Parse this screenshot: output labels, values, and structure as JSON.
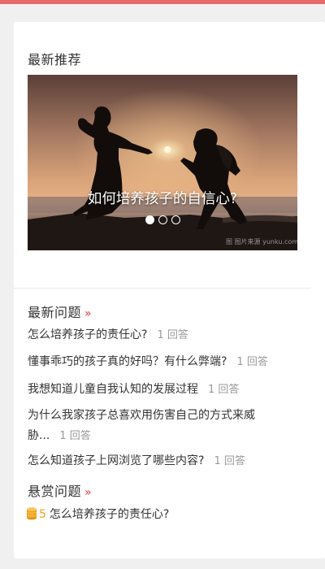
{
  "accent_color": "#e86a6a",
  "recommend": {
    "title": "最新推荐",
    "banner_caption": "如何培养孩子的自信心?",
    "watermark": "图 图片来源 yunku.com",
    "slide_count": 3,
    "active_slide": 1
  },
  "latest": {
    "title": "最新问题",
    "more": "»",
    "questions": [
      {
        "text": "怎么培养孩子的责任心?",
        "answers": "1 回答"
      },
      {
        "text": "懂事乖巧的孩子真的好吗？有什么弊端?",
        "answers": "1 回答"
      },
      {
        "text": "我想知道儿童自我认知的发展过程",
        "answers": "1 回答"
      },
      {
        "text": "为什么我家孩子总喜欢用伤害自己的方式来威胁...",
        "answers": "1 回答"
      },
      {
        "text": "怎么知道孩子上网浏览了哪些内容?",
        "answers": "1 回答"
      }
    ]
  },
  "reward": {
    "title": "悬赏问题",
    "more": "»",
    "coin_icon": "coin-stack-icon",
    "coin_color": "#f0a020",
    "items": [
      {
        "amount": "5",
        "text": "怎么培养孩子的责任心?"
      }
    ]
  }
}
